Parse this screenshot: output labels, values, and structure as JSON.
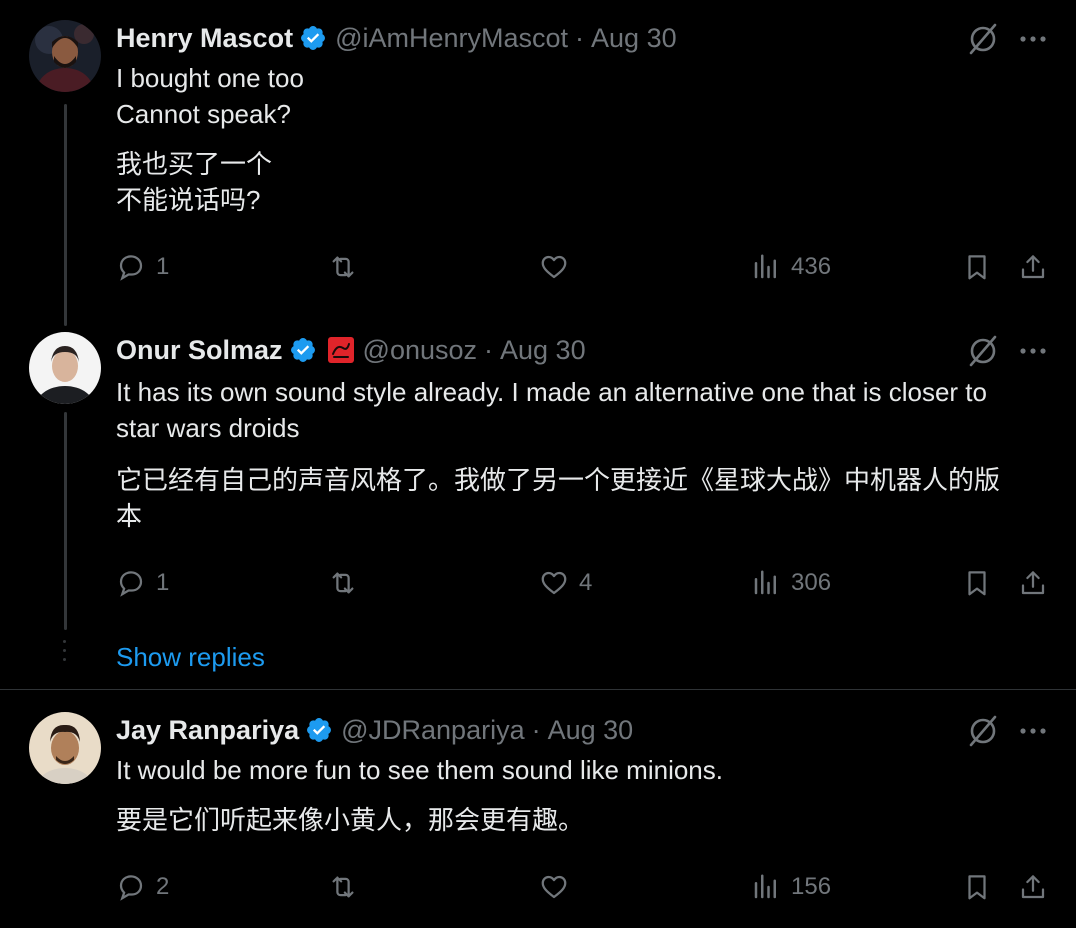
{
  "tweets": [
    {
      "name": "Henry Mascot",
      "handle": "@iAmHenryMascot",
      "sep": "·",
      "time": "Aug 30",
      "lines": [
        "I bought one too",
        "Cannot speak?"
      ],
      "translation": [
        "我也买了一个",
        "不能说话吗?"
      ],
      "replies": "1",
      "reposts": "",
      "likes": "",
      "views": "436"
    },
    {
      "name": "Onur Solmaz",
      "handle": "@onusoz",
      "sep": "·",
      "time": "Aug 30",
      "lines": [
        "It has its own sound style already. I made an alternative one that is closer to",
        "star wars droids"
      ],
      "translation": [
        "它已经有自己的声音风格了。我做了另一个更接近《星球大战》中机器人的版",
        "本"
      ],
      "replies": "1",
      "reposts": "",
      "likes": "4",
      "views": "306"
    },
    {
      "name": "Jay Ranpariya",
      "handle": "@JDRanpariya",
      "sep": "·",
      "time": "Aug 30",
      "lines": [
        "It would be more fun to see them sound like minions."
      ],
      "translation": [
        "要是它们听起来像小黄人，那会更有趣。"
      ],
      "replies": "2",
      "reposts": "",
      "likes": "",
      "views": "156"
    }
  ],
  "show_replies": "Show replies",
  "colors": {
    "background": "#000000",
    "text": "#e7e9ea",
    "secondary": "#71767b",
    "accent": "#1d9bf0",
    "verified": "#1d9bf0"
  },
  "icons": [
    "verified-badge-icon",
    "grok-icon",
    "more-icon",
    "reply-icon",
    "repost-icon",
    "like-icon",
    "views-icon",
    "bookmark-icon",
    "share-icon",
    "affiliate-flag-icon"
  ]
}
